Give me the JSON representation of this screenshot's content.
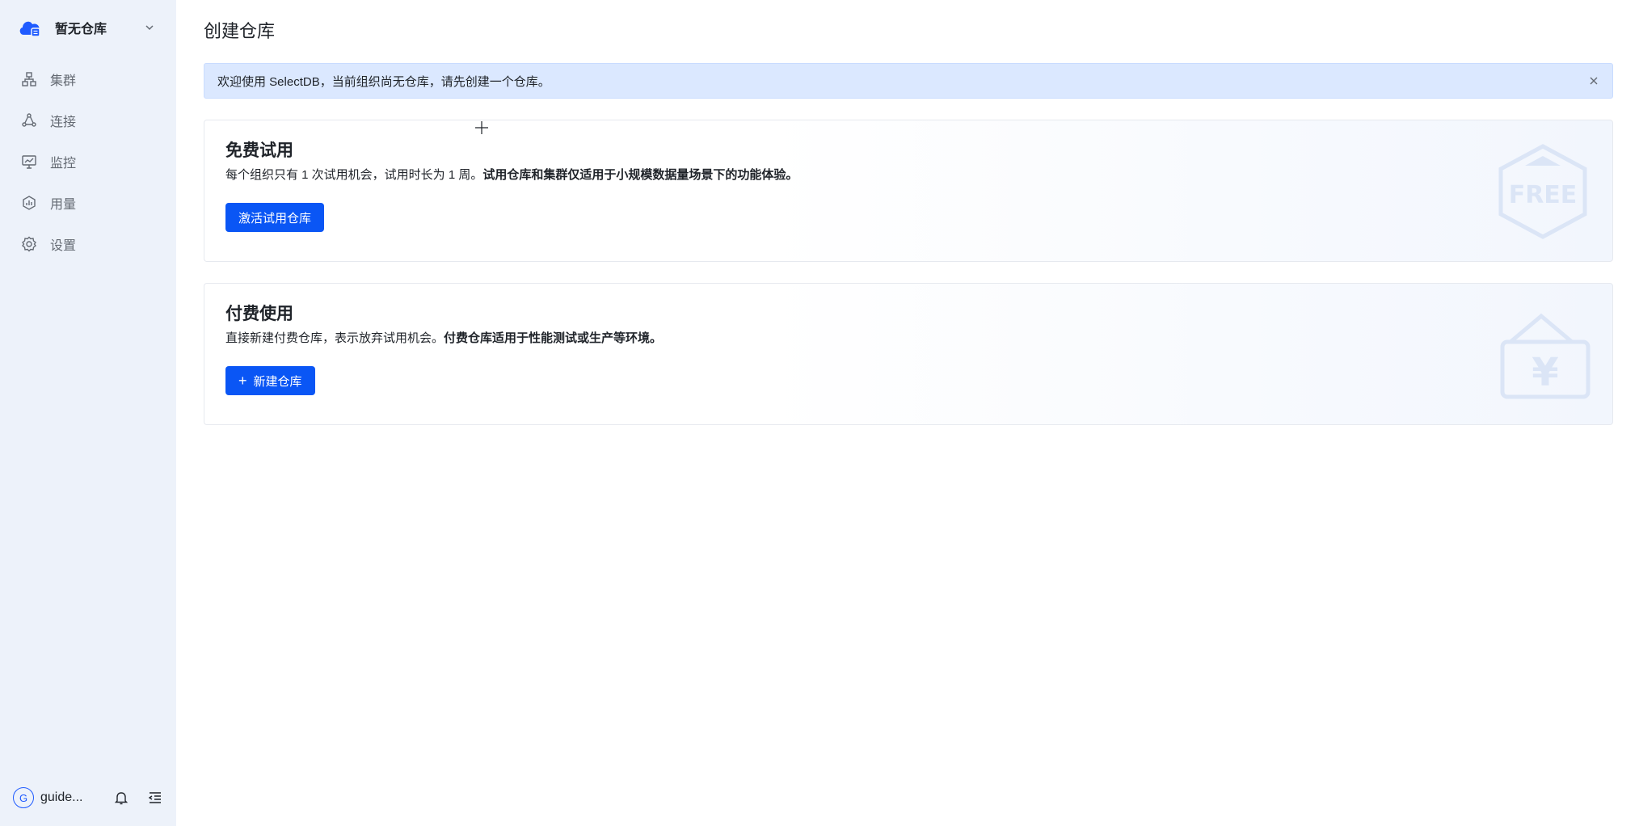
{
  "sidebar": {
    "workspace_name": "暂无仓库",
    "items": [
      {
        "id": "cluster",
        "label": "集群",
        "icon": "cluster-icon"
      },
      {
        "id": "connect",
        "label": "连接",
        "icon": "connect-icon"
      },
      {
        "id": "monitor",
        "label": "监控",
        "icon": "monitor-icon"
      },
      {
        "id": "usage",
        "label": "用量",
        "icon": "usage-icon"
      },
      {
        "id": "settings",
        "label": "设置",
        "icon": "gear-icon"
      }
    ],
    "user": {
      "avatar_letter": "G",
      "name": "guide..."
    }
  },
  "main": {
    "title": "创建仓库",
    "alert": {
      "text": "欢迎使用 SelectDB，当前组织尚无仓库，请先创建一个仓库。"
    },
    "trial": {
      "title": "免费试用",
      "desc_normal": "每个组织只有 1 次试用机会，试用时长为 1 周。",
      "desc_strong": "试用仓库和集群仅适用于小规模数据量场景下的功能体验。",
      "button": "激活试用仓库",
      "badge_text": "FREE"
    },
    "paid": {
      "title": "付费使用",
      "desc_normal": "直接新建付费仓库，表示放弃试用机会。",
      "desc_strong": "付费仓库适用于性能测试或生产等环境。",
      "button": "新建仓库",
      "badge_text": "¥"
    }
  },
  "colors": {
    "primary": "#0a56f5",
    "sidebar_bg": "#edf2fa",
    "alert_bg": "#dbe8ff",
    "text": "#1f2329",
    "muted": "#646a73"
  }
}
